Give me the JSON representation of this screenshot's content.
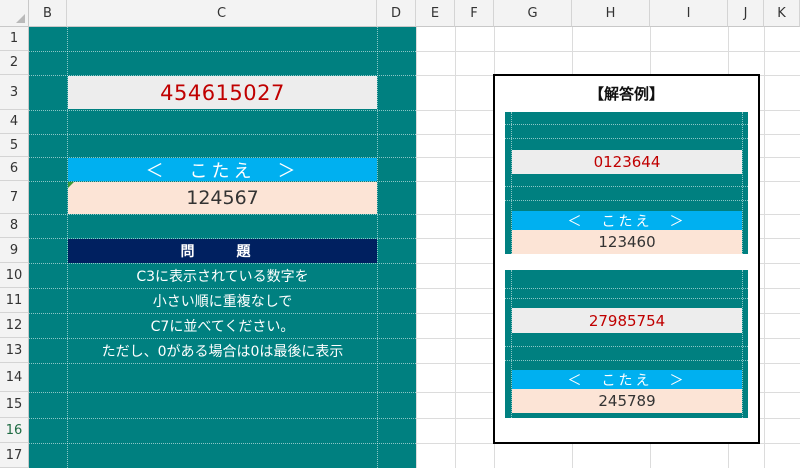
{
  "sheet": {
    "columns": [
      "B",
      "C",
      "D",
      "E",
      "F",
      "G",
      "H",
      "I",
      "J",
      "K"
    ],
    "rows": [
      "1",
      "2",
      "3",
      "4",
      "5",
      "6",
      "7",
      "8",
      "9",
      "10",
      "11",
      "12",
      "13",
      "14",
      "15",
      "16",
      "17"
    ],
    "selected_row": "16"
  },
  "puzzle": {
    "question_number": "454615027",
    "answer_header": "＜　こたえ　＞",
    "answer_value": "124567",
    "problem_title": "問　題",
    "problem_lines": [
      "C3に表示されている数字を",
      "小さい順に重複なしで",
      "C7に並べてください。",
      "ただし、0がある場合は0は最後に表示"
    ]
  },
  "examples": {
    "title": "【解答例】",
    "items": [
      {
        "question": "0123644",
        "answer_header": "＜　こたえ　＞",
        "answer": "123460"
      },
      {
        "question": "27985754",
        "answer_header": "＜　こたえ　＞",
        "answer": "245789"
      }
    ]
  },
  "colors": {
    "teal": "#008080",
    "question_text": "#c00000",
    "answer_header_bg": "#00b0f0",
    "answer_bg": "#fce4d6",
    "problem_header_bg": "#002060"
  }
}
